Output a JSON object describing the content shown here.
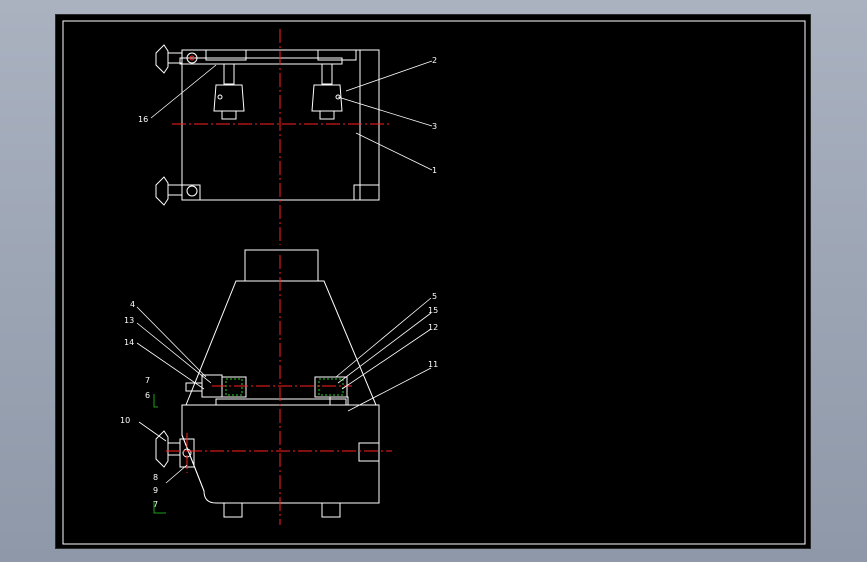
{
  "labels": {
    "top_view": [
      "2",
      "3",
      "1",
      "16"
    ],
    "front_view": [
      "4",
      "13",
      "14",
      "5",
      "15",
      "12",
      "11",
      "7",
      "6",
      "10",
      "8",
      "9",
      "7"
    ]
  },
  "colors": {
    "background": "#000000",
    "outline": "#ffffff",
    "centerline": "#ff2020",
    "hidden": "#1fd31f",
    "window": "#8e98a8"
  }
}
